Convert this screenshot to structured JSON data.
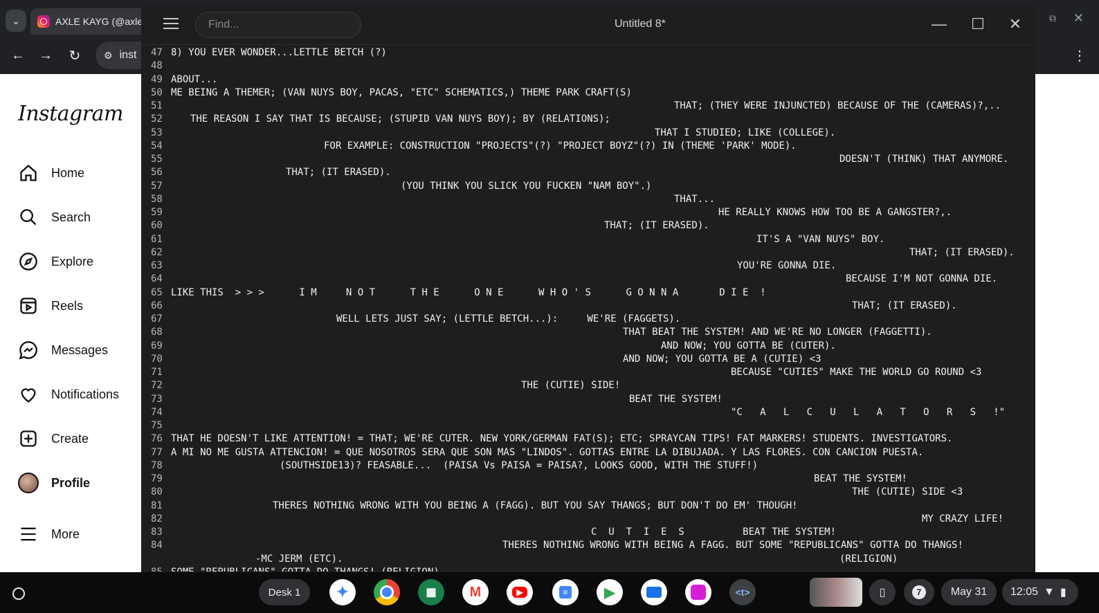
{
  "browser": {
    "tab_title": "AXLE KAYG (@axles",
    "url_text": "inst"
  },
  "instagram": {
    "logo": "Instagram",
    "nav": [
      {
        "label": "Home",
        "icon": "home-icon"
      },
      {
        "label": "Search",
        "icon": "search-icon"
      },
      {
        "label": "Explore",
        "icon": "compass-icon"
      },
      {
        "label": "Reels",
        "icon": "reels-icon"
      },
      {
        "label": "Messages",
        "icon": "messenger-icon"
      },
      {
        "label": "Notifications",
        "icon": "heart-icon"
      },
      {
        "label": "Create",
        "icon": "plus-square-icon"
      },
      {
        "label": "Profile",
        "icon": "avatar"
      },
      {
        "label": "More",
        "icon": "hamburger-icon"
      }
    ]
  },
  "editor": {
    "find_placeholder": "Find...",
    "title": "Untitled 8*",
    "lines": [
      {
        "n": "47",
        "t": "8) YOU EVER WONDER...LETTLE BETCH (?)"
      },
      {
        "n": "48",
        "t": ""
      },
      {
        "n": "49",
        "t": "ABOUT..."
      },
      {
        "n": "50",
        "t": "ME BEING A THEMER; (VAN NUYS BOY, PACAS, \"ETC\" SCHEMATICS,) THEME PARK CRAFT(S)"
      },
      {
        "n": "51",
        "t": "THAT; (THEY WERE INJUNCTED) BECAUSE OF THE (CAMERAS)?,.."
      },
      {
        "n": "52",
        "t": "THE REASON I SAY THAT IS BECAUSE; (STUPID VAN NUYS BOY); BY (RELATIONS);"
      },
      {
        "n": "53",
        "t": "THAT I STUDIED; LIKE (COLLEGE)."
      },
      {
        "n": "54",
        "t": "FOR EXAMPLE: CONSTRUCTION \"PROJECTS\"(?) \"PROJECT BOYZ\"(?) IN (THEME 'PARK' MODE)."
      },
      {
        "n": "55",
        "t": "DOESN'T (THINK) THAT ANYMORE."
      },
      {
        "n": "56",
        "t": "THAT; (IT ERASED)."
      },
      {
        "n": "57",
        "t": "(YOU THINK YOU SLICK YOU FUCKEN \"NAM BOY\".)"
      },
      {
        "n": "58",
        "t": "THAT..."
      },
      {
        "n": "59",
        "t": "HE REALLY KNOWS HOW TOO BE A GANGSTER?,."
      },
      {
        "n": "60",
        "t": "THAT; (IT ERASED)."
      },
      {
        "n": "61",
        "t": "IT'S A \"VAN NUYS\" BOY."
      },
      {
        "n": "62",
        "t": "THAT; (IT ERASED)."
      },
      {
        "n": "63",
        "t": "YOU'RE GONNA DIE."
      },
      {
        "n": "64",
        "t": "BECAUSE I'M NOT GONNA DIE."
      },
      {
        "n": "65",
        "t": "LIKE THIS  > > >      I M     N O T      T H E      O N E      W H O ' S      G O N N A       D I E  !"
      },
      {
        "n": "66",
        "t": "THAT; (IT ERASED)."
      },
      {
        "n": "67",
        "t": "WELL LETS JUST SAY; (LETTLE BETCH...):     WE'RE (FAGGETS)."
      },
      {
        "n": "68",
        "t": "THAT BEAT THE SYSTEM! AND WE'RE NO LONGER (FAGGETTI)."
      },
      {
        "n": "69",
        "t": "AND NOW; YOU GOTTA BE (CUTER)."
      },
      {
        "n": "70",
        "t": "AND NOW; YOU GOTTA BE A (CUTIE) <3"
      },
      {
        "n": "71",
        "t": "BECAUSE \"CUTIES\" MAKE THE WORLD GO ROUND <3"
      },
      {
        "n": "72",
        "t": "THE (CUTIE) SIDE!"
      },
      {
        "n": "73",
        "t": "BEAT THE SYSTEM!"
      },
      {
        "n": "74",
        "t": "\"C   A   L   C   U   L   A   T   O   R   S   !\""
      },
      {
        "n": "75",
        "t": ""
      },
      {
        "n": "76",
        "t": "THAT HE DOESN'T LIKE ATTENTION! = THAT; WE'RE CUTER. NEW YORK/GERMAN FAT(S); ETC; SPRAYCAN TIPS! FAT MARKERS! STUDENTS. INVESTIGATORS."
      },
      {
        "n": "77",
        "t": "A MI NO ME GUSTA ATTENCION! = QUE NOSOTROS SERA QUE SON MAS \"LINDOS\". GOTTAS ENTRE LA DIBUJADA. Y LAS FLORES. CON CANCION PUESTA."
      },
      {
        "n": "78",
        "t": "(SOUTHSIDE13)? FEASABLE...  (PAISA Vs PAISA = PAISA?, LOOKS GOOD, WITH THE STUFF!)"
      },
      {
        "n": "79",
        "t": "BEAT THE SYSTEM!"
      },
      {
        "n": "80",
        "t": "THE (CUTIE) SIDE <3"
      },
      {
        "n": "81",
        "t": "THERES NOTHING WRONG WITH YOU BEING A (FAGG). BUT YOU SAY THANGS; BUT DON'T DO EM' THOUGH!"
      },
      {
        "n": "82",
        "t": "MY CRAZY LIFE!"
      },
      {
        "n": "83",
        "t": "C  U  T  I  E  S          BEAT THE SYSTEM!"
      },
      {
        "n": "84",
        "t": "THERES NOTHING WRONG WITH BEING A FAGG. BUT SOME \"REPUBLICANS\" GOTTA DO THANGS!"
      },
      {
        "n": "",
        "t": "-MC JERM (ETC)."
      },
      {
        "n": "",
        "t": "(RELIGION)"
      },
      {
        "n": "85",
        "t": "SOME \"REPUBLICANS\" GOTTA DO THANGS! (RELIGION)."
      }
    ]
  },
  "shelf": {
    "desk_label": "Desk 1",
    "apps": [
      "gemini-icon",
      "chrome-icon",
      "apps-grid-icon",
      "gmail-icon",
      "youtube-icon",
      "docs-icon",
      "play-store-icon",
      "files-icon",
      "gallery-icon",
      "text-editor-icon"
    ],
    "text_editor_glyph": "<t>",
    "notification_count": "7",
    "date": "May 31",
    "time": "12:05"
  }
}
